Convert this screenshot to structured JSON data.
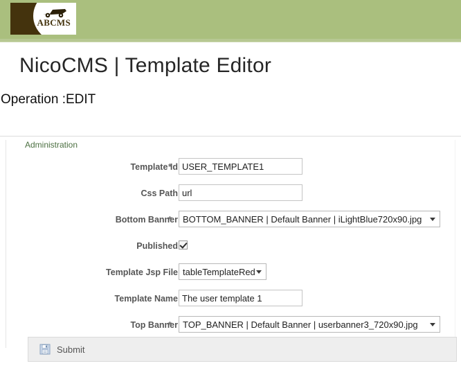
{
  "brand": {
    "logo_text": "ABCMS",
    "logo_icon": "cart-icon",
    "band_color": "#aabf7e",
    "logo_bg_color": "#44330d"
  },
  "header": {
    "title": "NicoCMS | Template Editor",
    "operation": "Operation :EDIT"
  },
  "form": {
    "legend": "Administration",
    "legend_color": "#4c7042",
    "required_marker": "*",
    "fields": [
      {
        "label": "Template Id",
        "required": true,
        "type": "text",
        "value": "USER_TEMPLATE1",
        "placeholder": ""
      },
      {
        "label": "Css Path",
        "required": false,
        "type": "text",
        "value": "url",
        "placeholder": ""
      },
      {
        "label": "Bottom Banner",
        "required": true,
        "type": "select",
        "value": "BOTTOM_BANNER | Default Banner | iLightBlue720x90.jpg"
      },
      {
        "label": "Published",
        "required": false,
        "type": "checkbox",
        "checked": true
      },
      {
        "label": "Template Jsp File",
        "required": false,
        "type": "select",
        "value": "tableTemplateRed"
      },
      {
        "label": "Template Name",
        "required": false,
        "type": "text",
        "value": "The user template 1",
        "placeholder": ""
      },
      {
        "label": "Top Banner",
        "required": true,
        "type": "select",
        "value": "TOP_BANNER | Default Banner | userbanner3_720x90.jpg"
      }
    ]
  },
  "actions": {
    "submit_label": "Submit",
    "submit_icon": "save-icon"
  }
}
